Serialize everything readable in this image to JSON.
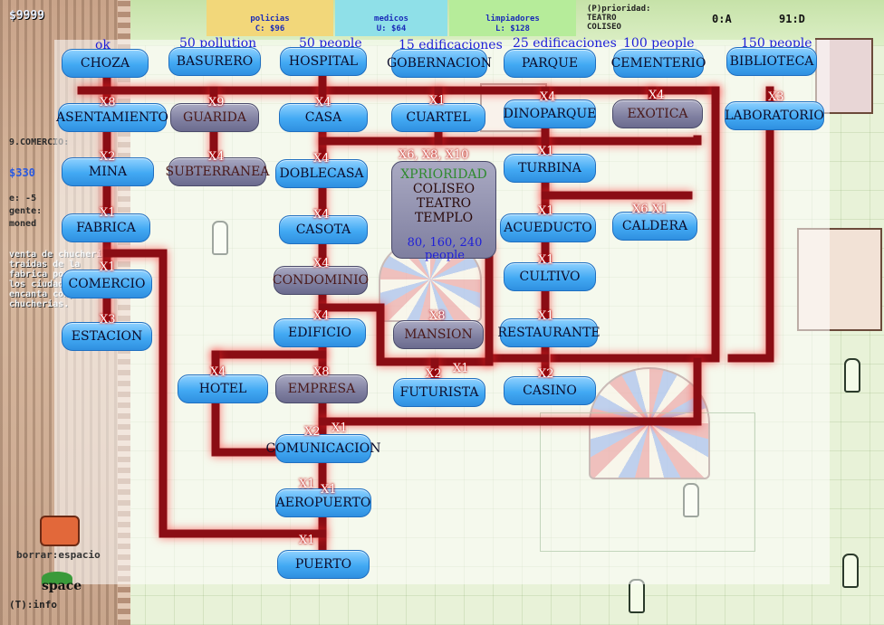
{
  "hud": {
    "money": "$9999",
    "tabs": [
      {
        "name": "policias",
        "cost": "C: $96"
      },
      {
        "name": "medicos",
        "cost": "U: $64"
      },
      {
        "name": "limpiadores",
        "cost": "L: $128"
      }
    ],
    "priority_title": "(P)prioridad:",
    "priority_items": [
      "TEATRO",
      "COLISEO"
    ],
    "counter_left": "0:A",
    "counter_right": "91:D"
  },
  "side": {
    "comercio_label": "9.COMERCIO:",
    "money": "$330",
    "stat_e": "e: -5",
    "stat_gente": "gente:",
    "stat_moneda": "moned",
    "description": "venta de chucherias traidas de la fabrica porque a los ciudadanos les encanta comprar chucherias."
  },
  "controls": {
    "borrar": "borrar:espacio",
    "space": "space",
    "info": "(T):info"
  },
  "tree": {
    "costs": [
      "ok",
      "50 pollution",
      "50 people",
      "15 edificaciones",
      "25 edificaciones",
      "100 people",
      "150 people"
    ],
    "nodes": [
      {
        "id": "choza",
        "label": "CHOZA",
        "locked": false
      },
      {
        "id": "basurero",
        "label": "BASURERO",
        "locked": false
      },
      {
        "id": "hospital",
        "label": "HOSPITAL",
        "locked": false
      },
      {
        "id": "gobernacion",
        "label": "GOBERNACION",
        "locked": false
      },
      {
        "id": "parque",
        "label": "PARQUE",
        "locked": false
      },
      {
        "id": "cementerio",
        "label": "CEMENTERIO",
        "locked": false
      },
      {
        "id": "biblioteca",
        "label": "BIBLIOTECA",
        "locked": false
      },
      {
        "id": "asentamiento",
        "label": "ASENTAMIENTO",
        "locked": false
      },
      {
        "id": "guarida",
        "label": "GUARIDA",
        "locked": true
      },
      {
        "id": "casa",
        "label": "CASA",
        "locked": false
      },
      {
        "id": "cuartel",
        "label": "CUARTEL",
        "locked": false
      },
      {
        "id": "dinoparque",
        "label": "DINOPARQUE",
        "locked": false
      },
      {
        "id": "exotica",
        "label": "EXOTICA",
        "locked": true
      },
      {
        "id": "laboratorio",
        "label": "LABORATORIO",
        "locked": false
      },
      {
        "id": "mina",
        "label": "MINA",
        "locked": false
      },
      {
        "id": "subterranea",
        "label": "SUBTERRANEA",
        "locked": true
      },
      {
        "id": "doblecasa",
        "label": "DOBLECASA",
        "locked": false
      },
      {
        "id": "turbina",
        "label": "TURBINA",
        "locked": false
      },
      {
        "id": "fabrica",
        "label": "FABRICA",
        "locked": false
      },
      {
        "id": "casota",
        "label": "CASOTA",
        "locked": false
      },
      {
        "id": "acueducto",
        "label": "ACUEDUCTO",
        "locked": false
      },
      {
        "id": "caldera",
        "label": "CALDERA",
        "locked": false
      },
      {
        "id": "comercio",
        "label": "COMERCIO",
        "locked": false
      },
      {
        "id": "condominio",
        "label": "CONDOMINIO",
        "locked": true
      },
      {
        "id": "cultivo",
        "label": "CULTIVO",
        "locked": false
      },
      {
        "id": "estacion",
        "label": "ESTACION",
        "locked": false
      },
      {
        "id": "edificio",
        "label": "EDIFICIO",
        "locked": false
      },
      {
        "id": "mansion",
        "label": "MANSION",
        "locked": true
      },
      {
        "id": "restaurante",
        "label": "RESTAURANTE",
        "locked": false
      },
      {
        "id": "hotel",
        "label": "HOTEL",
        "locked": false
      },
      {
        "id": "empresa",
        "label": "EMPRESA",
        "locked": true
      },
      {
        "id": "futurista",
        "label": "FUTURISTA",
        "locked": false
      },
      {
        "id": "casino",
        "label": "CASINO",
        "locked": false
      },
      {
        "id": "comunicacion",
        "label": "COMUNICACION",
        "locked": false
      },
      {
        "id": "aeropuerto",
        "label": "AEROPUERTO",
        "locked": false
      },
      {
        "id": "puerto",
        "label": "PUERTO",
        "locked": false
      }
    ],
    "multipliers": [
      "X8",
      "X9",
      "X4",
      "X1",
      "X4",
      "X4",
      "X3",
      "X2",
      "X4",
      "X4",
      "X6, X8, X10",
      "X1",
      "X1",
      "X4",
      "X1",
      "X6  X1",
      "X1",
      "X4",
      "X1",
      "X3",
      "X4",
      "X8",
      "X1",
      "X4",
      "X8",
      "X2",
      "X1",
      "X2",
      "X2",
      "X1",
      "X1",
      "X1",
      "X1"
    ],
    "priority_box": {
      "title": "XPRIORIDAD",
      "items": [
        "COLISEO",
        "TEATRO",
        "TEMPLO"
      ],
      "people": "80, 160, 240 people"
    }
  }
}
